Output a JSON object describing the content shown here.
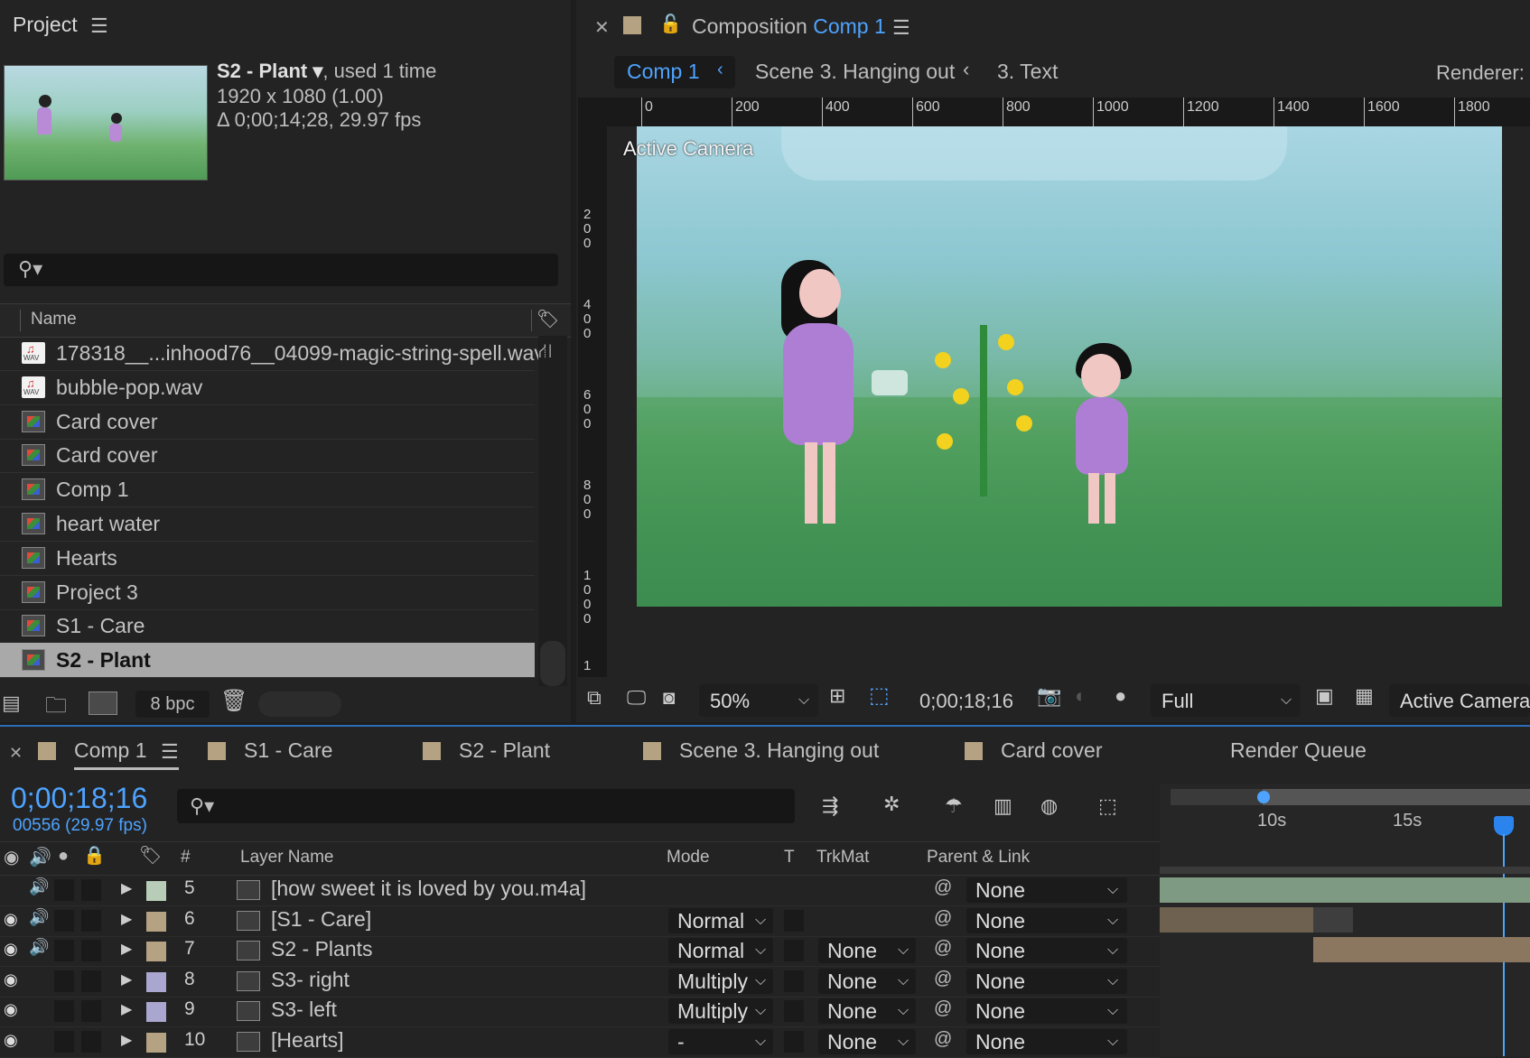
{
  "project": {
    "title": "Project",
    "selected_name": "S2 - Plant ▾",
    "selected_usage": ", used 1 time",
    "resolution": "1920 x 1080 (1.00)",
    "duration": "Δ 0;00;14;28, 29.97 fps",
    "column_name": "Name",
    "items": [
      {
        "label": "178318__...inhood76__04099-magic-string-spell.wav",
        "icon": "wav-file-icon"
      },
      {
        "label": "bubble-pop.wav",
        "icon": "wav-file-icon"
      },
      {
        "label": "Card cover",
        "icon": "composition-icon"
      },
      {
        "label": "Card cover",
        "icon": "composition-icon"
      },
      {
        "label": "Comp 1",
        "icon": "composition-icon"
      },
      {
        "label": "heart water",
        "icon": "composition-icon"
      },
      {
        "label": "Hearts",
        "icon": "composition-icon"
      },
      {
        "label": "Project 3",
        "icon": "composition-icon"
      },
      {
        "label": "S1 - Care",
        "icon": "composition-icon"
      },
      {
        "label": "S2 - Plant",
        "icon": "composition-icon",
        "selected": true
      }
    ],
    "bpc": "8 bpc"
  },
  "composition": {
    "title_prefix": "Composition",
    "title_comp": "Comp 1",
    "breadcrumbs": [
      "Comp 1",
      "Scene 3. Hanging out",
      "3. Text"
    ],
    "renderer_label": "Renderer:",
    "ruler_top": [
      "0",
      "200",
      "400",
      "600",
      "800",
      "1000",
      "1200",
      "1400",
      "1600",
      "1800"
    ],
    "ruler_left": [
      "200",
      "400",
      "600",
      "800",
      "1000",
      "1"
    ],
    "active_camera_overlay": "Active Camera",
    "zoom": "50%",
    "timecode": "0;00;18;16",
    "resolution": "Full",
    "view": "Active Camera"
  },
  "timeline": {
    "tabs": [
      "Comp 1",
      "S1 - Care",
      "S2 - Plant",
      "Scene 3. Hanging out",
      "Card cover",
      "Render Queue"
    ],
    "current_time": "0;00;18;16",
    "frame_info": "00556 (29.97 fps)",
    "headers": {
      "num": "#",
      "layer_name": "Layer Name",
      "mode": "Mode",
      "t": "T",
      "trkmat": "TrkMat",
      "parent": "Parent & Link"
    },
    "time_markers": [
      "10s",
      "15s"
    ],
    "layers": [
      {
        "num": "5",
        "name": "[how sweet it is loved by you.m4a]",
        "mode": "",
        "trkmat": "",
        "parent": "None",
        "color": "#b8cdb7",
        "icon": "audio-file-icon",
        "eye": false
      },
      {
        "num": "6",
        "name": "[S1 - Care]",
        "mode": "Normal",
        "trkmat": "",
        "parent": "None",
        "color": "#b5a283",
        "icon": "composition-icon",
        "eye": true
      },
      {
        "num": "7",
        "name": "S2 - Plants",
        "mode": "Normal",
        "trkmat": "None",
        "parent": "None",
        "color": "#b5a283",
        "icon": "composition-icon",
        "eye": true
      },
      {
        "num": "8",
        "name": "S3- right",
        "mode": "Multiply",
        "trkmat": "None",
        "parent": "None",
        "color": "#a9a7cf",
        "icon": "photoshop-file-icon",
        "eye": true
      },
      {
        "num": "9",
        "name": "S3- left",
        "mode": "Multiply",
        "trkmat": "None",
        "parent": "None",
        "color": "#a9a7cf",
        "icon": "photoshop-file-icon",
        "eye": true
      },
      {
        "num": "10",
        "name": "[Hearts]",
        "mode": "-",
        "trkmat": "None",
        "parent": "None",
        "color": "#b5a283",
        "icon": "composition-icon",
        "eye": true
      }
    ]
  },
  "colors": {
    "accent": "#4ea3ff",
    "panel": "#232323",
    "selection": "#a9a9a9"
  }
}
